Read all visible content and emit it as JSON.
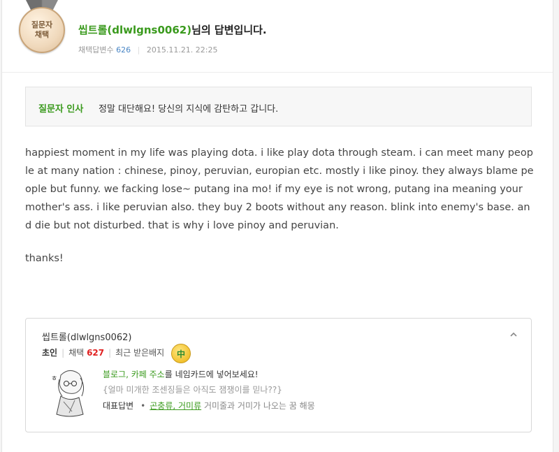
{
  "header": {
    "medal_line1": "질문자",
    "medal_line2": "채택",
    "username": "씹트롤(dlwlgns0062)",
    "title_suffix": "님의 답변입니다.",
    "adopted_label": "채택답변수",
    "adopted_count": "626",
    "datetime": "2015.11.21. 22:25"
  },
  "thanks": {
    "label": "질문자 인사",
    "message": "정말 대단해요! 당신의 지식에 감탄하고 갑니다."
  },
  "answer": {
    "body": "happiest moment in my life was playing dota. i like play dota through steam. i can meet many people at many nation : chinese, pinoy, peruvian, europian etc. mostly i like pinoy. they always blame people but funny. we facking lose~ putang ina mo! if my eye is not wrong, putang ina meaning your mother's ass. i like peruvian also. they buy 2 boots without any reason. blink into enemy's base. and die but not disturbed. that is why i love pinoy and peruvian.",
    "closing": "thanks!"
  },
  "profile": {
    "name": "씹트롤(dlwlgns0062)",
    "rank": "초인",
    "adopted_label": "채택",
    "adopted_count": "627",
    "badge_label": "최근 받은배지",
    "badge_char": "中",
    "promo_highlight": "블로그, 카페 주소",
    "promo_rest": "를 네임카드에 넣어보세요!",
    "quote": "{얼마 미개한 조센징들은 아직도 잼쟁이를 믿나??}",
    "rep_label": "대표답변",
    "rep_bullet": "•",
    "rep_link": "곤충류, 거미류",
    "rep_rest": " 거미줄과 거미가 나오는 꿈 해몽"
  },
  "colors": {
    "accent_green": "#3a9a1d",
    "count_red": "#e02020",
    "count_blue": "#4a86c5"
  },
  "icons": {
    "collapse": "chevron-up-icon",
    "medal": "medal-icon",
    "badge": "badge-icon",
    "avatar": "avatar"
  }
}
